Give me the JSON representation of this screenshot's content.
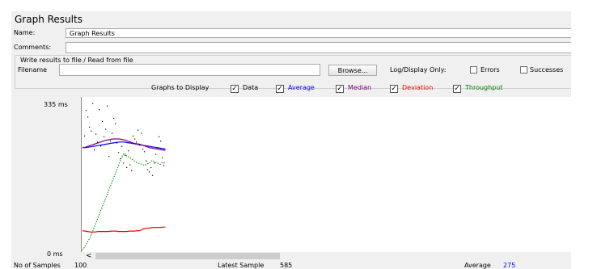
{
  "window_title": "Graph Results",
  "name": {
    "label": "Name:",
    "value": "Graph Results"
  },
  "comments": {
    "label": "Comments:",
    "value": ""
  },
  "file_group": {
    "title": "Write results to file / Read from file",
    "filename_label": "Filename",
    "filename_value": "",
    "browse_label": "Browse...",
    "log_display_label": "Log/Display Only:",
    "errors_label": "Errors",
    "errors_checked": false,
    "successes_label": "Successes",
    "successes_checked": false
  },
  "graphs": {
    "label": "Graphs to Display",
    "options": [
      {
        "label": "Data",
        "checked": true,
        "color": "#000000"
      },
      {
        "label": "Average",
        "checked": true,
        "color": "#0000ff"
      },
      {
        "label": "Median",
        "checked": true,
        "color": "#800080"
      },
      {
        "label": "Deviation",
        "checked": true,
        "color": "#ff0000"
      },
      {
        "label": "Throughput",
        "checked": true,
        "color": "#008000"
      }
    ]
  },
  "y_axis": {
    "max_label": "335 ms",
    "min_label": "0 ms",
    "max": 335
  },
  "scroll_left_glyph": "<",
  "footer": {
    "samples_label": "No of Samples",
    "samples_value": "100",
    "latest_label": "Latest Sample",
    "latest_value": "585",
    "average_label": "Average",
    "average_value": "275"
  },
  "chart_data": {
    "type": "line",
    "title": "",
    "ylim": [
      0,
      335
    ],
    "series": [
      {
        "name": "Average",
        "color": "#0000ff",
        "values": [
          235,
          234,
          235,
          236,
          237,
          238,
          239,
          240,
          241,
          242,
          243,
          244,
          245,
          246,
          247,
          247,
          247,
          246,
          245,
          244,
          243,
          242,
          241,
          240,
          239,
          238,
          237,
          236,
          235,
          234,
          233,
          232,
          231
        ]
      },
      {
        "name": "Median",
        "color": "#800080",
        "values": [
          234,
          235,
          237,
          239,
          241,
          243,
          245,
          247,
          249,
          251,
          252,
          253,
          254,
          254,
          254,
          253,
          252,
          250,
          248,
          246,
          244,
          243,
          242,
          240,
          238,
          236,
          234,
          233,
          232,
          231,
          230,
          229,
          228
        ]
      },
      {
        "name": "Deviation",
        "color": "#ff0000",
        "values": [
          45,
          44,
          43,
          42,
          42,
          42,
          43,
          43,
          43,
          43,
          43,
          44,
          44,
          44,
          43,
          43,
          43,
          43,
          44,
          44,
          44,
          45,
          45,
          48,
          50,
          51,
          51,
          52,
          52,
          52,
          52,
          53,
          53
        ]
      },
      {
        "name": "Throughput",
        "color": "#008000",
        "values": [
          0,
          10,
          20,
          30,
          45,
          60,
          75,
          90,
          105,
          120,
          135,
          150,
          165,
          180,
          195,
          210,
          222,
          216,
          213,
          208,
          204,
          200,
          198,
          196,
          194,
          197,
          200,
          205,
          201,
          199,
          196,
          201,
          198
        ]
      }
    ],
    "data_points": [
      [
        1,
        262
      ],
      [
        2,
        320
      ],
      [
        3,
        305
      ],
      [
        4,
        282
      ],
      [
        5,
        273
      ],
      [
        6,
        336
      ],
      [
        7,
        230
      ],
      [
        8,
        266
      ],
      [
        9,
        248
      ],
      [
        10,
        322
      ],
      [
        11,
        239
      ],
      [
        12,
        295
      ],
      [
        13,
        260
      ],
      [
        14,
        277
      ],
      [
        15,
        330
      ],
      [
        16,
        215
      ],
      [
        17,
        250
      ],
      [
        18,
        268
      ],
      [
        19,
        302
      ],
      [
        20,
        290
      ],
      [
        21,
        246
      ],
      [
        22,
        224
      ],
      [
        23,
        210
      ],
      [
        24,
        238
      ],
      [
        25,
        200
      ],
      [
        26,
        218
      ],
      [
        27,
        190
      ],
      [
        28,
        228
      ],
      [
        29,
        196
      ],
      [
        30,
        183
      ],
      [
        31,
        262
      ],
      [
        32,
        255
      ],
      [
        33,
        248
      ],
      [
        34,
        275
      ],
      [
        35,
        241
      ],
      [
        36,
        268
      ],
      [
        37,
        232
      ],
      [
        38,
        226
      ],
      [
        39,
        205
      ],
      [
        40,
        185
      ],
      [
        41,
        180
      ],
      [
        42,
        190
      ],
      [
        43,
        172
      ],
      [
        44,
        200
      ],
      [
        45,
        220
      ],
      [
        46,
        235
      ],
      [
        47,
        260
      ],
      [
        48,
        250
      ],
      [
        49,
        212
      ],
      [
        50,
        195
      ]
    ]
  }
}
